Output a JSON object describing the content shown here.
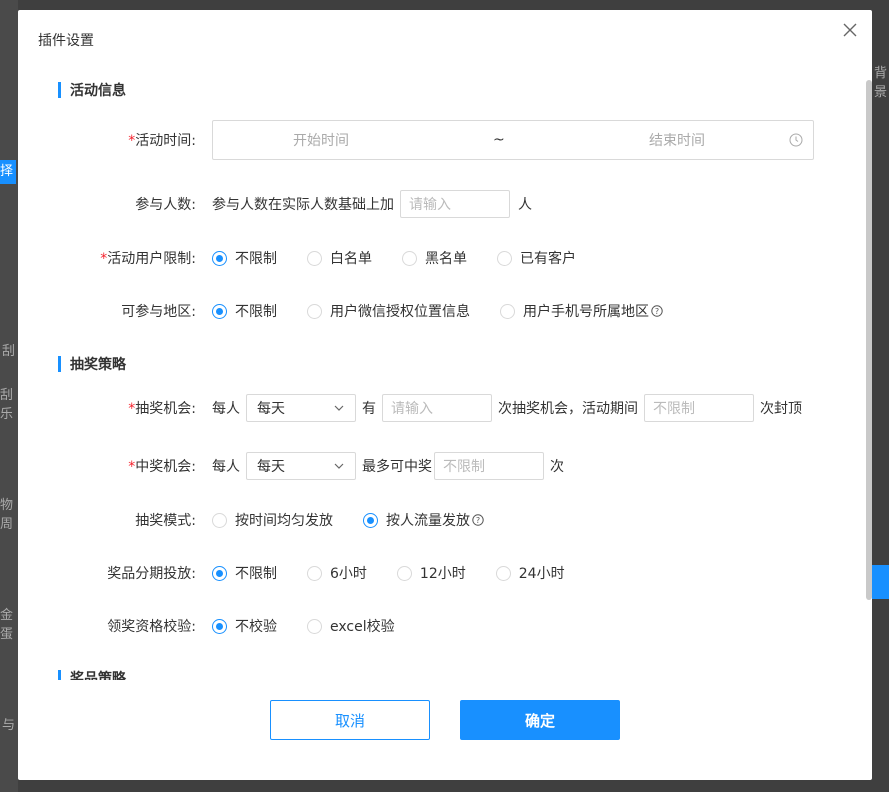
{
  "modal": {
    "title": "插件设置",
    "ok_label": "确定",
    "cancel_label": "取消"
  },
  "sections": {
    "activity": "活动信息",
    "lottery": "抽奖策略",
    "prize": "奖品策略"
  },
  "activity_time": {
    "label": "活动时间:",
    "start_placeholder": "开始时间",
    "separator": "~",
    "end_placeholder": "结束时间"
  },
  "participants": {
    "label": "参与人数:",
    "prefix": "参与人数在实际人数基础上加",
    "placeholder": "请输入",
    "suffix": "人"
  },
  "user_limit": {
    "label": "活动用户限制:",
    "options": [
      "不限制",
      "白名单",
      "黑名单",
      "已有客户"
    ],
    "selected": "不限制"
  },
  "region": {
    "label": "可参与地区:",
    "options": [
      "不限制",
      "用户微信授权位置信息",
      "用户手机号所属地区"
    ],
    "selected": "不限制"
  },
  "draw_chance": {
    "label": "抽奖机会:",
    "per_person": "每人",
    "period": "每天",
    "has": "有",
    "placeholder": "请输入",
    "middle": "次抽奖机会，活动期间",
    "cap_placeholder": "不限制",
    "suffix": "次封顶"
  },
  "win_chance": {
    "label": "中奖机会:",
    "per_person": "每人",
    "period": "每天",
    "max_text": "最多可中奖",
    "placeholder": "不限制",
    "suffix": "次"
  },
  "draw_mode": {
    "label": "抽奖模式:",
    "options": [
      "按时间均匀发放",
      "按人流量发放"
    ],
    "selected": "按人流量发放"
  },
  "staging": {
    "label": "奖品分期投放:",
    "options": [
      "不限制",
      "6小时",
      "12小时",
      "24小时"
    ],
    "selected": "不限制"
  },
  "verify": {
    "label": "领奖资格校验:",
    "options": [
      "不校验",
      "excel校验"
    ],
    "selected": "不校验"
  },
  "colors": {
    "primary": "#1890ff",
    "required": "#f5222d",
    "overlay": "#3f3f3f"
  },
  "background": {
    "left_labels": [
      "择",
      "刮",
      "刮乐",
      "物周",
      "金蛋",
      "与"
    ],
    "right_labels": [
      "背景"
    ]
  }
}
